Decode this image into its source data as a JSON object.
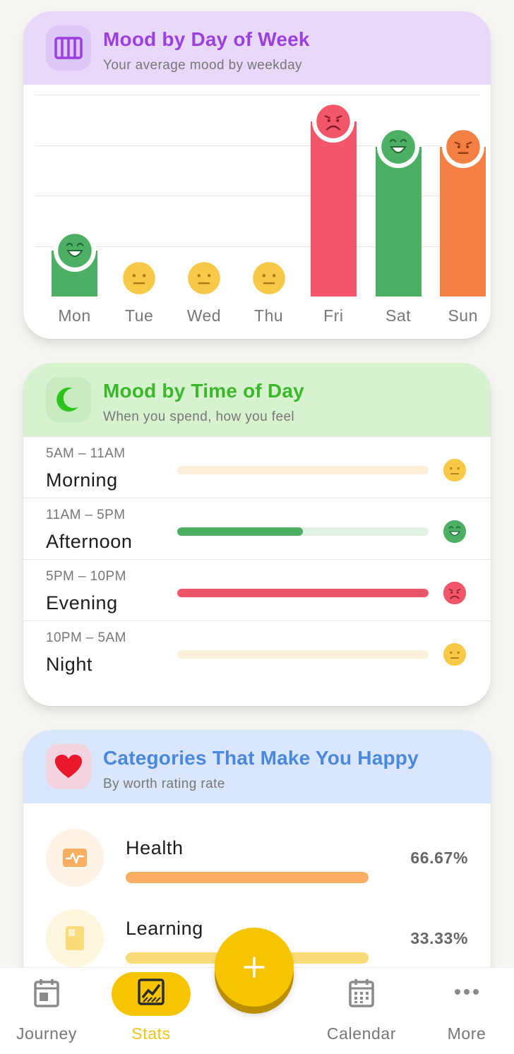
{
  "week_card": {
    "title": "Mood by Day of Week",
    "subtitle": "Your average mood by weekday",
    "title_color": "#9b3fe0",
    "icon": "calendar-bars-icon"
  },
  "chart_data": {
    "type": "bar",
    "categories": [
      "Mon",
      "Tue",
      "Wed",
      "Thu",
      "Fri",
      "Sat",
      "Sun"
    ],
    "values": [
      1.25,
      0,
      0,
      0,
      3.8,
      3.3,
      3.3
    ],
    "moods": [
      "happy",
      "neutral",
      "neutral",
      "neutral",
      "sad",
      "happy",
      "meh"
    ],
    "colors": [
      "#4caf64",
      "#f7c948",
      "#f7c948",
      "#f7c948",
      "#f2566a",
      "#4caf64",
      "#f47f43"
    ],
    "ylim": [
      0,
      4
    ],
    "grid": true
  },
  "time_card": {
    "title": "Mood by Time of Day",
    "subtitle": "When you spend, how you feel",
    "title_color": "#3bb72a",
    "icon": "moon-icon",
    "rows": [
      {
        "range": "5AM – 11AM",
        "name": "Morning",
        "fill": 0,
        "fill_color": "#4caf64",
        "track_color": "#fcf1d8",
        "mood": "neutral"
      },
      {
        "range": "11AM – 5PM",
        "name": "Afternoon",
        "fill": 0.5,
        "fill_color": "#4caf64",
        "track_color": "#dff2e4",
        "mood": "happy"
      },
      {
        "range": "5PM – 10PM",
        "name": "Evening",
        "fill": 1,
        "fill_color": "#f2566a",
        "track_color": "#fde0e3",
        "mood": "sad"
      },
      {
        "range": "10PM – 5AM",
        "name": "Night",
        "fill": 0,
        "fill_color": "#4caf64",
        "track_color": "#fcf1d8",
        "mood": "neutral"
      }
    ]
  },
  "cat_card": {
    "title": "Categories That Make You Happy",
    "subtitle": "By worth rating rate",
    "title_color": "#4a88de",
    "icon": "heart-icon",
    "items": [
      {
        "name": "Health",
        "percent": "66.67%",
        "bar_color": "#f9ae63",
        "icon": "health-pulse-icon",
        "icon_bg": "#fff3e7",
        "icon_color": "#f9ae63"
      },
      {
        "name": "Learning",
        "percent": "33.33%",
        "bar_color": "#fadb7a",
        "icon": "book-icon",
        "icon_bg": "#fff7dd",
        "icon_color": "#fadb7a"
      }
    ]
  },
  "nav": {
    "items": [
      {
        "label": "Journey",
        "icon": "journal-icon",
        "active": false
      },
      {
        "label": "Stats",
        "icon": "chart-icon",
        "active": true
      },
      {
        "label": "Calendar",
        "icon": "calendar-icon",
        "active": false
      },
      {
        "label": "More",
        "icon": "more-dots-icon",
        "active": false
      }
    ],
    "fab_icon": "plus-icon",
    "accent": "#f6c400"
  }
}
